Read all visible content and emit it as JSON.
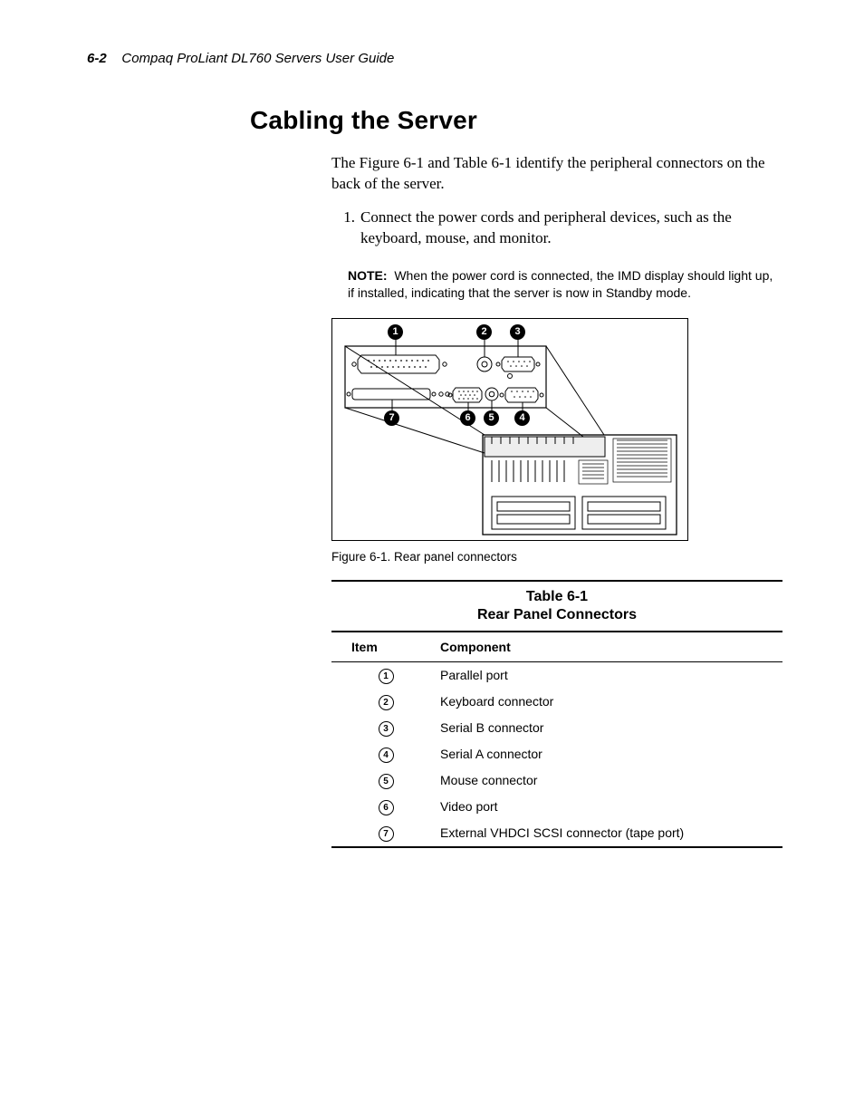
{
  "header": {
    "page_number": "6-2",
    "title": "Compaq ProLiant DL760 Servers User Guide"
  },
  "section_heading": "Cabling the Server",
  "intro_paragraph": "The Figure 6-1 and Table 6-1 identify the peripheral connectors on the back of the server.",
  "step": {
    "number": "1.",
    "text": "Connect the power cords and peripheral devices, such as the keyboard, mouse, and monitor."
  },
  "note": {
    "label": "NOTE:",
    "text": "When the power cord is connected, the IMD display should light up, if installed, indicating that the server is now in Standby mode."
  },
  "figure": {
    "caption": "Figure 6-1.   Rear panel connectors",
    "callouts": [
      "1",
      "2",
      "3",
      "4",
      "5",
      "6",
      "7"
    ]
  },
  "table": {
    "number": "Table 6-1",
    "title": "Rear Panel Connectors",
    "headers": {
      "item": "Item",
      "component": "Component"
    },
    "rows": [
      {
        "item": "1",
        "component": "Parallel port"
      },
      {
        "item": "2",
        "component": "Keyboard connector"
      },
      {
        "item": "3",
        "component": "Serial B connector"
      },
      {
        "item": "4",
        "component": "Serial A connector"
      },
      {
        "item": "5",
        "component": "Mouse connector"
      },
      {
        "item": "6",
        "component": "Video port"
      },
      {
        "item": "7",
        "component": "External VHDCI SCSI connector (tape port)"
      }
    ]
  }
}
